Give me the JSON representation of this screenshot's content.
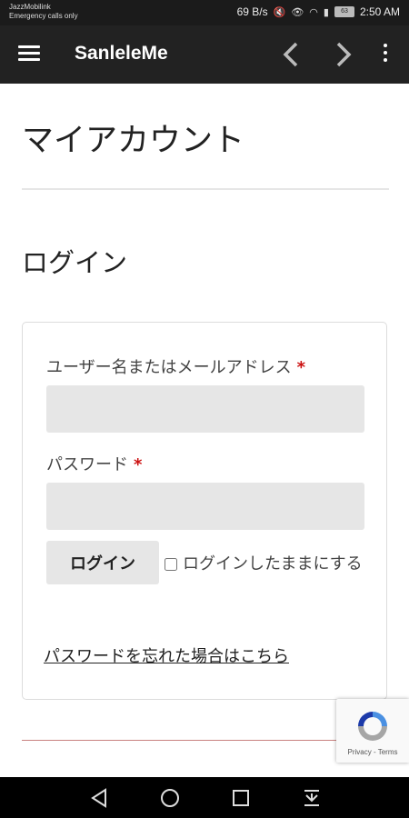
{
  "status_bar": {
    "carrier": "JazzMobilink",
    "carrier_sub": "Emergency calls only",
    "speed": "69 B/s",
    "battery": "63",
    "time": "2:50 AM"
  },
  "app_bar": {
    "title": "SanleleMe",
    "icons": [
      "menu-icon",
      "back-icon",
      "forward-icon",
      "more-icon"
    ]
  },
  "page": {
    "title": "マイアカウント",
    "login_heading": "ログイン"
  },
  "login_form": {
    "username_label": "ユーザー名またはメールアドレス",
    "password_label": "パスワード",
    "required_mark": "*",
    "username_value": "",
    "password_value": "",
    "login_button": "ログイン",
    "remember_label": "ログインしたままにする",
    "forgot_link": "パスワードを忘れた場合はこちら"
  },
  "recaptcha": {
    "terms": "Privacy - Terms"
  },
  "colors": {
    "app_bar": "#222222",
    "required": "#cc1111",
    "input_bg": "#e6e6e6"
  }
}
